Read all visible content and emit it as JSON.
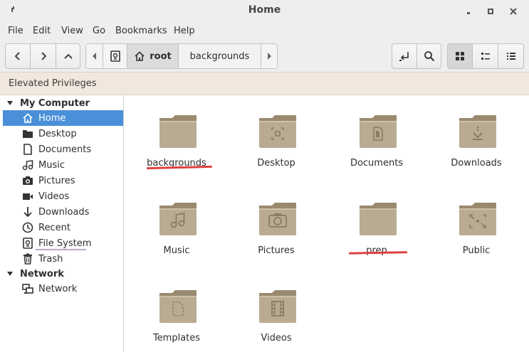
{
  "window": {
    "title": "Home",
    "controls": [
      "minimize-icon",
      "maximize-icon",
      "close-icon"
    ]
  },
  "menubar": {
    "items": [
      "File",
      "Edit",
      "View",
      "Go",
      "Bookmarks",
      "Help"
    ]
  },
  "toolbar": {
    "nav": [
      "back-icon",
      "forward-icon",
      "up-icon"
    ],
    "breadcrumb": {
      "segments": [
        "root",
        "backgrounds"
      ],
      "icons": [
        "drive-icon",
        "home-icon"
      ]
    },
    "right": [
      "open-terminal-icon",
      "search-icon"
    ],
    "views": [
      "grid-view-icon",
      "compact-view-icon",
      "list-view-icon"
    ]
  },
  "banner": {
    "text": "Elevated Privileges"
  },
  "sidebar": {
    "sections": [
      {
        "title": "My Computer",
        "items": [
          {
            "label": "Home",
            "icon": "home-icon",
            "selected": true
          },
          {
            "label": "Desktop",
            "icon": "desktop-folder-icon"
          },
          {
            "label": "Documents",
            "icon": "document-icon"
          },
          {
            "label": "Music",
            "icon": "music-note-icon"
          },
          {
            "label": "Pictures",
            "icon": "camera-icon"
          },
          {
            "label": "Videos",
            "icon": "video-icon"
          },
          {
            "label": "Downloads",
            "icon": "download-arrow-icon"
          },
          {
            "label": "Recent",
            "icon": "clock-icon"
          },
          {
            "label": "File System",
            "icon": "drive-icon"
          },
          {
            "label": "Trash",
            "icon": "trash-icon"
          }
        ]
      },
      {
        "title": "Network",
        "items": [
          {
            "label": "Network",
            "icon": "network-computers-icon"
          }
        ]
      }
    ]
  },
  "files": [
    {
      "name": "backgrounds",
      "emblem": "none"
    },
    {
      "name": "Desktop",
      "emblem": "desktop"
    },
    {
      "name": "Documents",
      "emblem": "documents"
    },
    {
      "name": "Downloads",
      "emblem": "downloads"
    },
    {
      "name": "Music",
      "emblem": "music"
    },
    {
      "name": "Pictures",
      "emblem": "pictures"
    },
    {
      "name": "prep",
      "emblem": "none"
    },
    {
      "name": "Public",
      "emblem": "public"
    },
    {
      "name": "Templates",
      "emblem": "templates"
    },
    {
      "name": "Videos",
      "emblem": "videos"
    }
  ],
  "colors": {
    "selection": "#4a90d9",
    "folder": "#b9ab92",
    "annotation": "#e04040",
    "banner": "#f1e7dd"
  }
}
